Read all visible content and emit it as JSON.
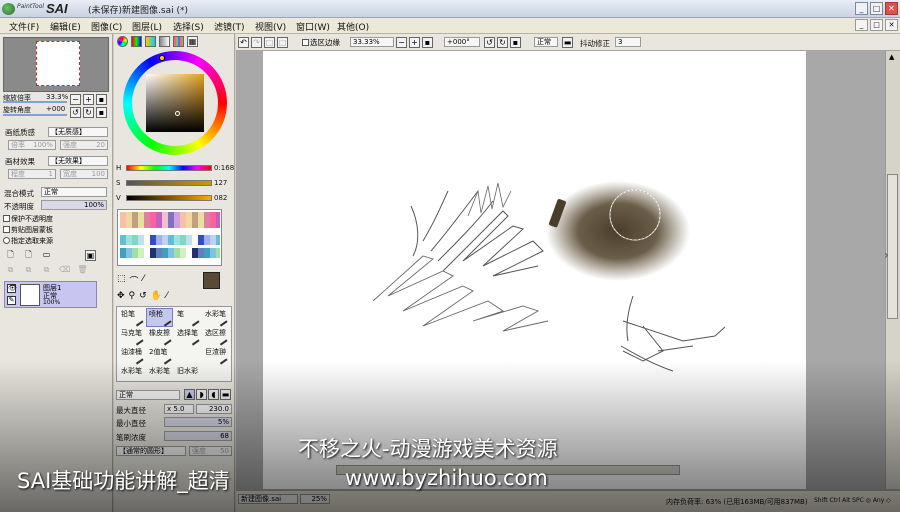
{
  "window": {
    "app_name_small": "PaintTool",
    "app_name": "SAI",
    "title": "(未保存)新建图像.sai (*)"
  },
  "menu": {
    "items": [
      "文件(F)",
      "编辑(E)",
      "图像(C)",
      "图层(L)",
      "选择(S)",
      "滤镜(T)",
      "视图(V)",
      "窗口(W)",
      "其他(O)"
    ]
  },
  "navigator": {
    "zoom_label": "缩放倍率",
    "zoom_value": "33.3%",
    "angle_label": "旋转角度",
    "angle_value": "+000"
  },
  "paper": {
    "texture_label": "画纸质感",
    "texture_value": "【无质感】",
    "scale_label": "倍率",
    "scale_value": "100%",
    "strength_label": "强度",
    "strength_value": "20",
    "effect_label": "画材效果",
    "effect_value": "【无效果】",
    "degree_label": "程度",
    "degree_value": "1",
    "width_label": "宽度",
    "width_value": "100"
  },
  "layer_opts": {
    "blend_label": "混合模式",
    "blend_value": "正常",
    "opacity_label": "不透明度",
    "opacity_value": "100%",
    "protect_alpha": "保护不透明度",
    "clipping": "剪贴图层蒙板",
    "selection_source": "指定选取来源"
  },
  "layer": {
    "name": "图层1",
    "mode": "正常",
    "opacity": "100%"
  },
  "hsv": {
    "h_label": "H",
    "h_value": "0:168",
    "s_label": "S",
    "s_value": "127",
    "v_label": "V",
    "v_value": "082"
  },
  "brushes": [
    {
      "label": "铅笔"
    },
    {
      "label": "喷枪",
      "selected": true
    },
    {
      "label": "笔"
    },
    {
      "label": "水彩笔"
    },
    {
      "label": "马克笔"
    },
    {
      "label": "橡皮擦"
    },
    {
      "label": "选择笔"
    },
    {
      "label": "选区擦"
    },
    {
      "label": "油漆桶"
    },
    {
      "label": "2值笔"
    },
    {
      "label": ""
    },
    {
      "label": "巨渣翀"
    },
    {
      "label": "水彩笔"
    },
    {
      "label": "水彩笔"
    },
    {
      "label": "旧水彩"
    },
    {
      "label": ""
    }
  ],
  "brush_settings": {
    "mode_value": "正常",
    "max_size_label": "最大直径",
    "max_mult": "x 5.0",
    "max_size_value": "230.0",
    "min_size_label": "最小直径",
    "min_size_value": "5%",
    "density_label": "笔刷浓度",
    "density_value": "68",
    "shape_value": "【通常的圆形】",
    "strength_label": "强度",
    "strength_value": "50"
  },
  "options": {
    "sel_edge_label": "选区边缘",
    "zoom_value": "33.33%",
    "angle_value": "+000°",
    "mode_value": "正常",
    "stabilizer_label": "抖动修正",
    "stabilizer_value": "3"
  },
  "status": {
    "file_tab": "新建图像.sai",
    "file_zoom": "25%",
    "memory": "内存负荷率: 63% (已用163MB/可用837MB)",
    "keys": "Shift Ctrl Alt SPC ◎ Any ◇"
  },
  "watermark": {
    "line1": "不移之火-动漫游戏美术资源",
    "line2": "www.byzhihuo.com",
    "caption": "SAI基础功能讲解_超清"
  }
}
